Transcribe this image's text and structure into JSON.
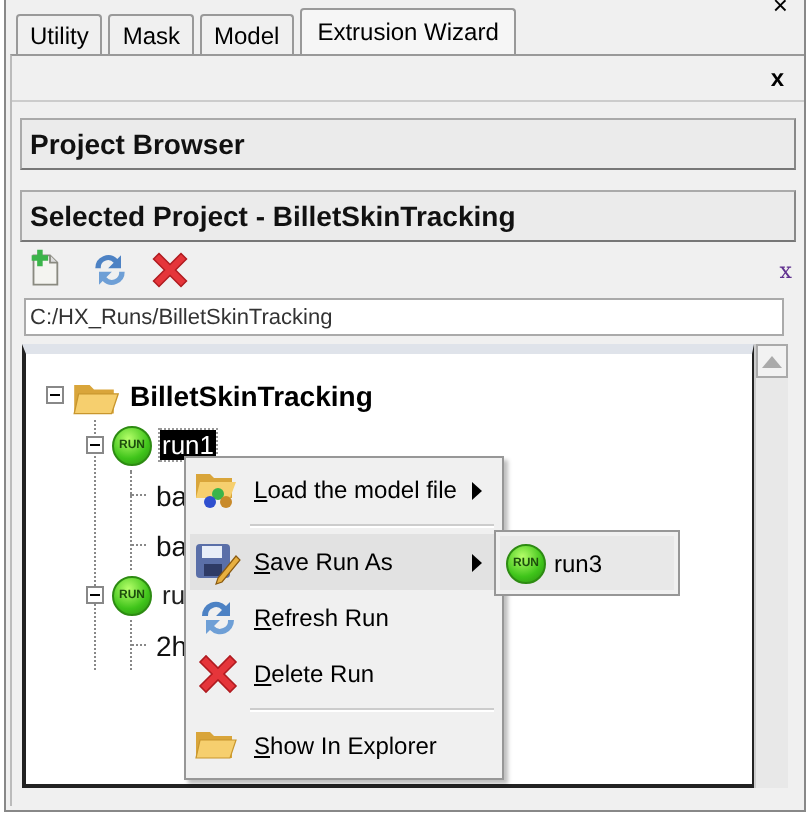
{
  "window": {
    "close": "×"
  },
  "tabs": [
    {
      "label": "Utility",
      "selected": false
    },
    {
      "label": "Mask",
      "selected": false
    },
    {
      "label": "Model",
      "selected": false
    },
    {
      "label": "Extrusion Wizard",
      "selected": true
    }
  ],
  "panel_close": "x",
  "sections": [
    {
      "title": "Project Browser"
    },
    {
      "title": "Selected Project - BilletSkinTracking"
    }
  ],
  "toolbar": {
    "close": "x"
  },
  "path_field": {
    "value": "C:/HX_Runs/BilletSkinTracking"
  },
  "tree": [
    {
      "label": "BilletSkinTracking",
      "kind": "project",
      "expanded": true,
      "children": [
        {
          "label": "run1",
          "kind": "run",
          "icon_text": "RUN",
          "selected": true,
          "expanded": true,
          "children": [
            {
              "label": "ba",
              "kind": "file"
            },
            {
              "label": "ba",
              "kind": "file"
            }
          ]
        },
        {
          "label": "ru",
          "kind": "run",
          "icon_text": "RUN",
          "selected": false,
          "expanded": true,
          "children": [
            {
              "label": "2h",
              "kind": "file"
            }
          ]
        }
      ]
    }
  ],
  "context_menu": {
    "items": [
      {
        "label": "Load the model file",
        "kind": "load",
        "underline_first": true,
        "submenu": true,
        "selected": false
      },
      {
        "kind": "separator"
      },
      {
        "label": "Save Run As",
        "kind": "save",
        "underline_first": true,
        "submenu": true,
        "selected": true
      },
      {
        "label": "Refresh Run",
        "kind": "refresh",
        "underline_first": true,
        "submenu": false,
        "selected": false
      },
      {
        "label": "Delete Run",
        "kind": "delete",
        "underline_first": true,
        "submenu": false,
        "selected": false
      },
      {
        "kind": "separator"
      },
      {
        "label": "Show In Explorer",
        "kind": "explorer",
        "underline_first": true,
        "submenu": false,
        "selected": false
      }
    ]
  },
  "submenu": {
    "items": [
      {
        "label": "run3",
        "icon_text": "RUN"
      }
    ]
  }
}
